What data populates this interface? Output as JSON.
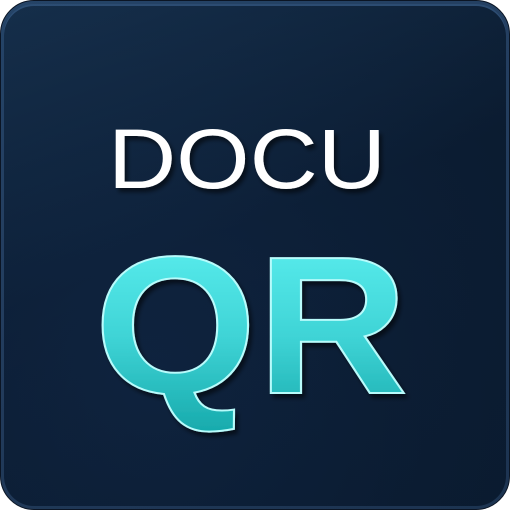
{
  "icon": {
    "line1": "DOCU",
    "line2": "QR"
  },
  "colors": {
    "background_top": "#12304f",
    "background_bottom": "#0a1a2e",
    "border": "#233d5e",
    "docu_text": "#ffffff",
    "qr_gradient_top": "#5ff3f3",
    "qr_gradient_bottom": "#18aeb0"
  }
}
